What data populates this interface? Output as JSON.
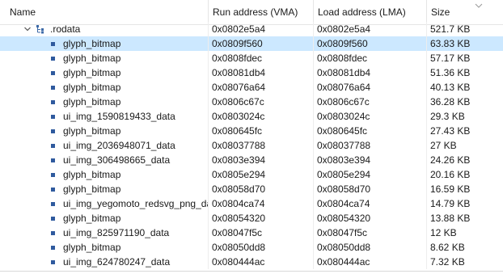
{
  "columns": {
    "name": "Name",
    "run_address": "Run address (VMA)",
    "load_address": "Load address (LMA)",
    "size": "Size"
  },
  "section": {
    "label": ".rodata",
    "vma": "0x0802e5a4",
    "lma": "0x0802e5a4",
    "size": "521.7 KB",
    "expanded": true
  },
  "rows": [
    {
      "name": "glyph_bitmap",
      "vma": "0x0809f560",
      "lma": "0x0809f560",
      "size": "63.83 KB",
      "selected": true
    },
    {
      "name": "glyph_bitmap",
      "vma": "0x0808fdec",
      "lma": "0x0808fdec",
      "size": "57.17 KB",
      "selected": false
    },
    {
      "name": "glyph_bitmap",
      "vma": "0x08081db4",
      "lma": "0x08081db4",
      "size": "51.36 KB",
      "selected": false
    },
    {
      "name": "glyph_bitmap",
      "vma": "0x08076a64",
      "lma": "0x08076a64",
      "size": "40.13 KB",
      "selected": false
    },
    {
      "name": "glyph_bitmap",
      "vma": "0x0806c67c",
      "lma": "0x0806c67c",
      "size": "36.28 KB",
      "selected": false
    },
    {
      "name": "ui_img_1590819433_data",
      "vma": "0x0803024c",
      "lma": "0x0803024c",
      "size": "29.3 KB",
      "selected": false
    },
    {
      "name": "glyph_bitmap",
      "vma": "0x080645fc",
      "lma": "0x080645fc",
      "size": "27.43 KB",
      "selected": false
    },
    {
      "name": "ui_img_2036948071_data",
      "vma": "0x08037788",
      "lma": "0x08037788",
      "size": "27 KB",
      "selected": false
    },
    {
      "name": "ui_img_306498665_data",
      "vma": "0x0803e394",
      "lma": "0x0803e394",
      "size": "24.26 KB",
      "selected": false
    },
    {
      "name": "glyph_bitmap",
      "vma": "0x0805e294",
      "lma": "0x0805e294",
      "size": "20.16 KB",
      "selected": false
    },
    {
      "name": "glyph_bitmap",
      "vma": "0x08058d70",
      "lma": "0x08058d70",
      "size": "16.59 KB",
      "selected": false
    },
    {
      "name": "ui_img_yegomoto_redsvg_png_data",
      "vma": "0x0804ca74",
      "lma": "0x0804ca74",
      "size": "14.79 KB",
      "selected": false
    },
    {
      "name": "glyph_bitmap",
      "vma": "0x08054320",
      "lma": "0x08054320",
      "size": "13.88 KB",
      "selected": false
    },
    {
      "name": "ui_img_825971190_data",
      "vma": "0x08047f5c",
      "lma": "0x08047f5c",
      "size": "12 KB",
      "selected": false
    },
    {
      "name": "glyph_bitmap",
      "vma": "0x08050dd8",
      "lma": "0x08050dd8",
      "size": "8.62 KB",
      "selected": false
    },
    {
      "name": "ui_img_624780247_data",
      "vma": "0x080444ac",
      "lma": "0x080444ac",
      "size": "7.32 KB",
      "selected": false
    }
  ],
  "icons": {
    "expander": "chevron-down-icon",
    "section": "section-tree-icon",
    "item": "symbol-square-icon",
    "sort": "sort-descending-icon"
  },
  "colors": {
    "selected_row": "#cce8ff",
    "symbol_icon": "#2f5a9e",
    "section_icon": "#3d6aa8",
    "grid_line": "#e5e5e5"
  }
}
